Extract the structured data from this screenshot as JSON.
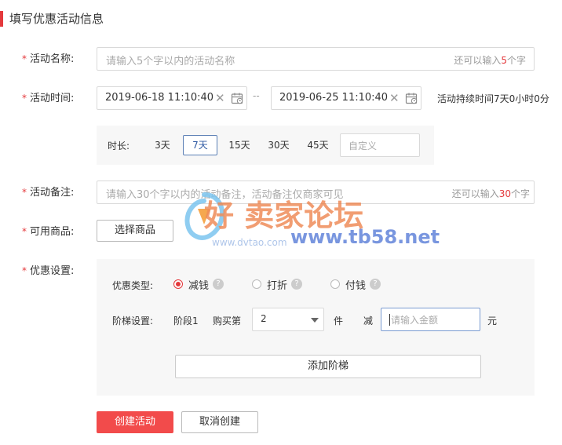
{
  "header": {
    "title": "填写优惠活动信息"
  },
  "required_mark": "*",
  "name_field": {
    "label": "活动名称:",
    "placeholder": "请输入5个字以内的活动名称",
    "hint_prefix": "还可以输入",
    "hint_count": "5",
    "hint_suffix": "个字"
  },
  "time_field": {
    "label": "活动时间:",
    "start": "2019-06-18 11:10:40",
    "separator": "--",
    "end": "2019-06-25 11:10:40",
    "duration_text": "活动持续时间7天0小时0分"
  },
  "duration": {
    "label": "时长:",
    "options": [
      "3天",
      "7天",
      "15天",
      "30天",
      "45天"
    ],
    "selected": "7天",
    "custom_placeholder": "自定义"
  },
  "note_field": {
    "label": "活动备注:",
    "placeholder": "请输入30个字以内的活动备注，活动备注仅商家可见",
    "hint_prefix": "还可以输入",
    "hint_count": "30",
    "hint_suffix": "个字"
  },
  "goods_field": {
    "label": "可用商品:",
    "button": "选择商品"
  },
  "discount": {
    "label": "优惠设置:",
    "type_label": "优惠类型:",
    "types": [
      "减钱",
      "打折",
      "付钱"
    ],
    "selected_type": "减钱",
    "tier_label": "阶梯设置:",
    "tier_name": "阶段1",
    "buy_label": "购买第",
    "buy_value": "2",
    "unit": "件",
    "minus": "减",
    "amount_placeholder": "请输入金额",
    "currency": "元",
    "add_button": "添加阶梯"
  },
  "actions": {
    "create": "创建活动",
    "cancel": "取消创建"
  },
  "watermark": {
    "main": "好 卖家论坛",
    "site": "www.tb58.net",
    "sub": "www.dvtao.com"
  },
  "colors": {
    "accent": "#e4393c",
    "primary_button": "#f24b4b",
    "active_border": "#5b7fb5"
  }
}
